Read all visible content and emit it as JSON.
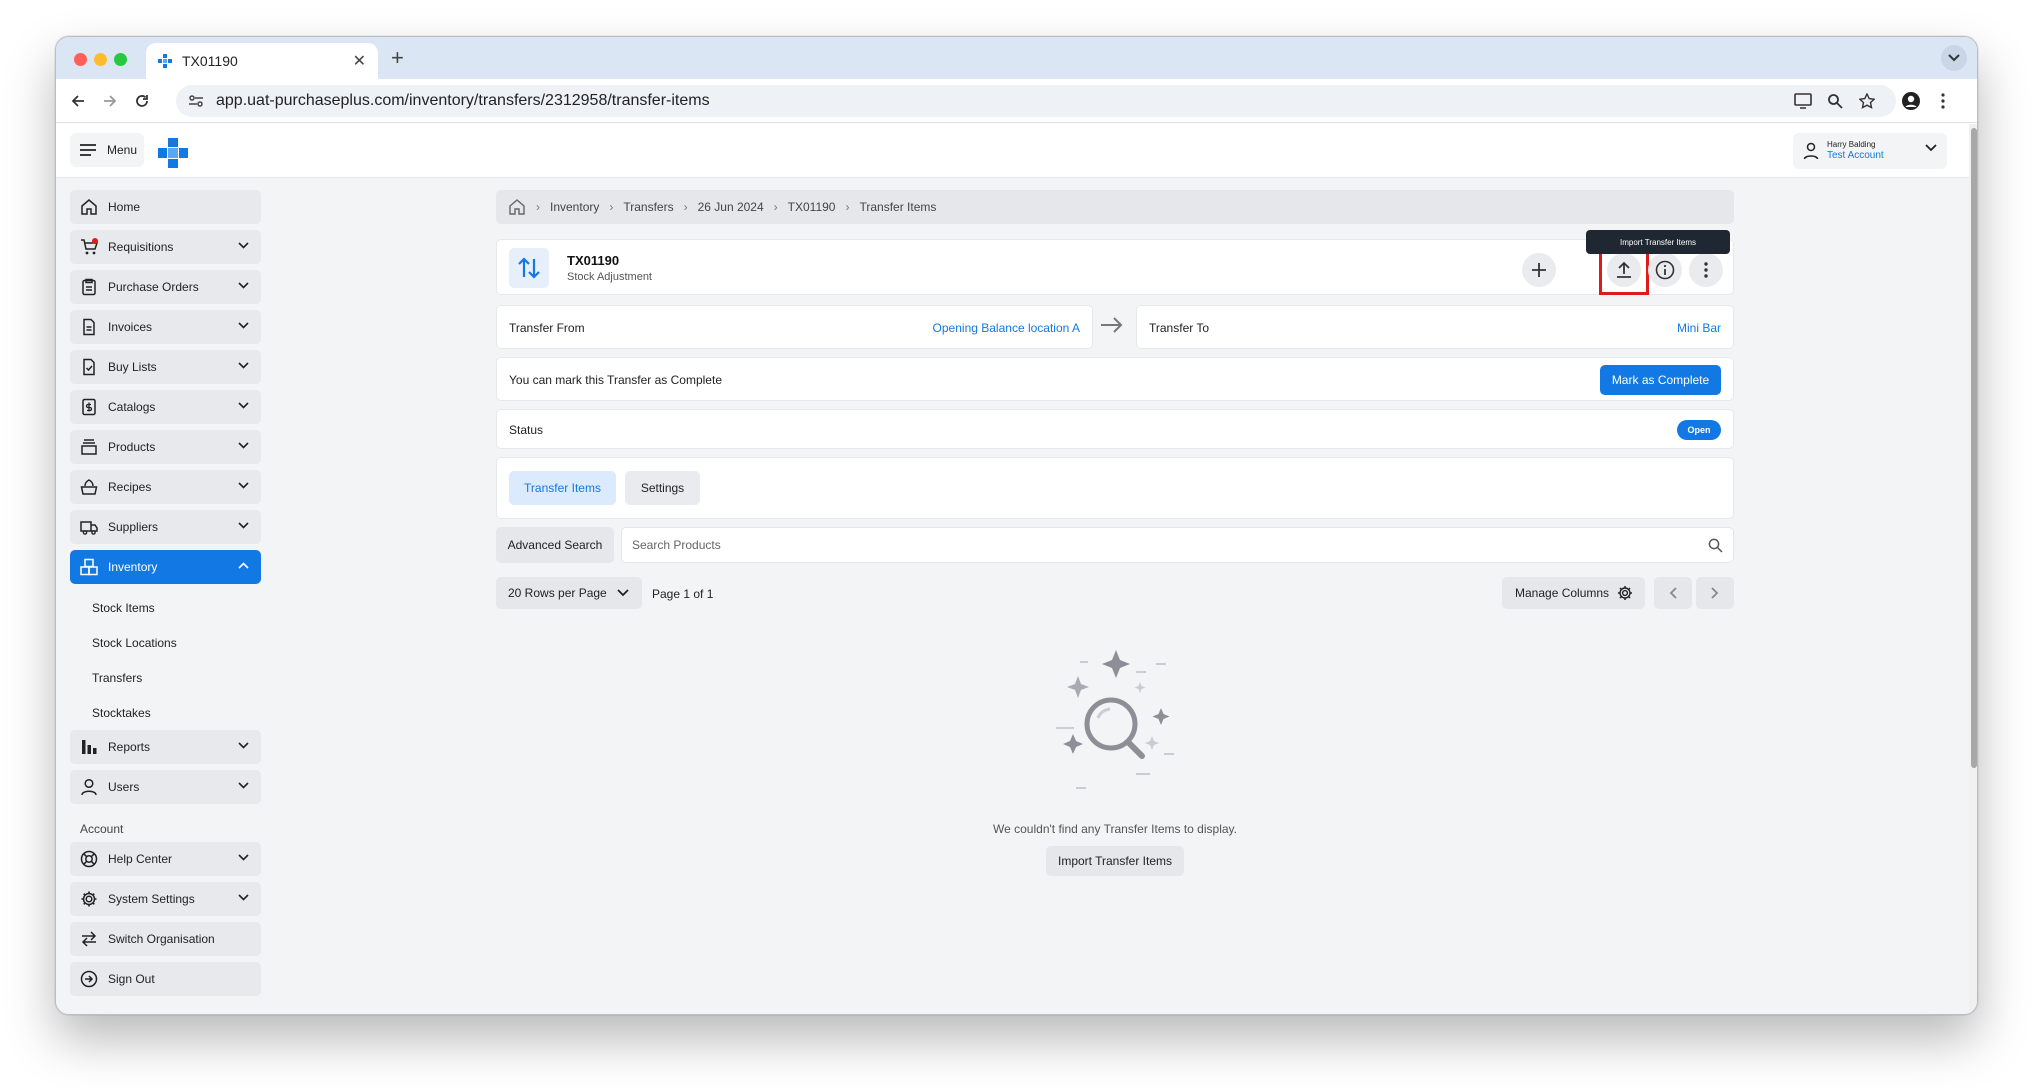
{
  "browser": {
    "tab_title": "TX01190",
    "url": "app.uat-purchaseplus.com/inventory/transfers/2312958/transfer-items"
  },
  "header": {
    "menu_label": "Menu",
    "user_name": "Harry Balding",
    "account_name": "Test Account"
  },
  "sidebar": {
    "items": [
      {
        "label": "Home",
        "icon": "home-icon"
      },
      {
        "label": "Requisitions",
        "icon": "cart-icon"
      },
      {
        "label": "Purchase Orders",
        "icon": "clipboard-icon"
      },
      {
        "label": "Invoices",
        "icon": "invoice-icon"
      },
      {
        "label": "Buy Lists",
        "icon": "checklist-icon"
      },
      {
        "label": "Catalogs",
        "icon": "catalog-icon"
      },
      {
        "label": "Products",
        "icon": "products-icon"
      },
      {
        "label": "Recipes",
        "icon": "recipe-icon"
      },
      {
        "label": "Suppliers",
        "icon": "truck-icon"
      },
      {
        "label": "Inventory",
        "icon": "inventory-icon"
      }
    ],
    "inventory_sub": [
      "Stock Items",
      "Stock Locations",
      "Transfers",
      "Stocktakes"
    ],
    "items2": [
      {
        "label": "Reports",
        "icon": "chart-icon"
      },
      {
        "label": "Users",
        "icon": "user-icon"
      }
    ],
    "account_section_label": "Account",
    "account_items": [
      {
        "label": "Help Center",
        "icon": "lifebuoy-icon"
      },
      {
        "label": "System Settings",
        "icon": "gear-icon"
      },
      {
        "label": "Switch Organisation",
        "icon": "switch-icon"
      },
      {
        "label": "Sign Out",
        "icon": "sign-out-icon"
      }
    ]
  },
  "breadcrumb": [
    "Inventory",
    "Transfers",
    "26 Jun 2024",
    "TX01190",
    "Transfer Items"
  ],
  "transfer": {
    "id": "TX01190",
    "type": "Stock Adjustment",
    "tooltip": "Import Transfer Items",
    "from_label": "Transfer From",
    "from_value": "Opening Balance location A",
    "to_label": "Transfer To",
    "to_value": "Mini Bar",
    "mark_text": "You can mark this Transfer as Complete",
    "mark_button": "Mark as Complete",
    "status_label": "Status",
    "status_value": "Open"
  },
  "tabs": [
    "Transfer Items",
    "Settings"
  ],
  "toolbar": {
    "advanced_search": "Advanced Search",
    "search_placeholder": "Search Products",
    "rows_per_page": "20 Rows per Page",
    "page_info": "Page 1 of 1",
    "manage_columns": "Manage Columns"
  },
  "empty": {
    "message": "We couldn't find any Transfer Items to display.",
    "button": "Import Transfer Items"
  },
  "colors": {
    "accent": "#1279e4",
    "highlight": "#e0191b",
    "tooltip_bg": "#1f2733"
  }
}
